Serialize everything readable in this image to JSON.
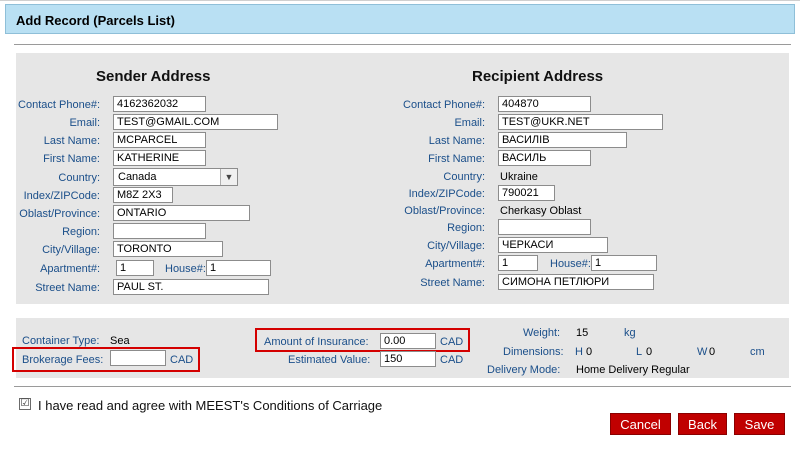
{
  "header": {
    "title": "Add Record (Parcels List)"
  },
  "sender": {
    "heading": "Sender Address",
    "contact_phone_label": "Contact Phone#:",
    "contact_phone": "4162362032",
    "email_label": "Email:",
    "email": "TEST@GMAIL.COM",
    "last_name_label": "Last Name:",
    "last_name": "MCPARCEL",
    "first_name_label": "First Name:",
    "first_name": "KATHERINE",
    "country_label": "Country:",
    "country": "Canada",
    "zip_label": "Index/ZIPCode:",
    "zip": "M8Z 2X3",
    "oblast_label": "Oblast/Province:",
    "oblast": "ONTARIO",
    "region_label": "Region:",
    "region": "",
    "city_label": "City/Village:",
    "city": "TORONTO",
    "apartment_label": "Apartment#:",
    "apartment": "1",
    "house_label": "House#:",
    "house": "1",
    "street_label": "Street Name:",
    "street": "PAUL ST."
  },
  "recipient": {
    "heading": "Recipient Address",
    "contact_phone_label": "Contact Phone#:",
    "contact_phone": "404870",
    "email_label": "Email:",
    "email": "TEST@UKR.NET",
    "last_name_label": "Last Name:",
    "last_name": "ВАСИЛІВ",
    "first_name_label": "First Name:",
    "first_name": "ВАСИЛЬ",
    "country_label": "Country:",
    "country": "Ukraine",
    "zip_label": "Index/ZIPCode:",
    "zip": "790021",
    "oblast_label": "Oblast/Province:",
    "oblast": "Cherkasy Oblast",
    "region_label": "Region:",
    "region": "",
    "city_label": "City/Village:",
    "city": "ЧЕРКАСИ",
    "apartment_label": "Apartment#:",
    "apartment": "1",
    "house_label": "House#:",
    "house": "1",
    "street_label": "Street Name:",
    "street": "СИМОНА ПЕТЛЮРИ"
  },
  "details": {
    "container_type_label": "Container Type:",
    "container_type": "Sea",
    "brokerage_label": "Brokerage Fees:",
    "brokerage": "",
    "brokerage_unit": "CAD",
    "insurance_label": "Amount of Insurance:",
    "insurance": "0.00",
    "insurance_unit": "CAD",
    "estimated_label": "Estimated Value:",
    "estimated": "150",
    "estimated_unit": "CAD",
    "weight_label": "Weight:",
    "weight": "15",
    "weight_unit": "kg",
    "dimensions_label": "Dimensions:",
    "h_label": "H",
    "h": "0",
    "l_label": "L",
    "l": "0",
    "w_label": "W",
    "w": "0",
    "dim_unit": "cm",
    "delivery_label": "Delivery Mode:",
    "delivery": "Home Delivery Regular"
  },
  "agreement": {
    "checked_mark": "☑",
    "text": "I have read and agree with MEEST's Conditions of Carriage"
  },
  "buttons": {
    "cancel": "Cancel",
    "back": "Back",
    "save": "Save"
  },
  "colors": {
    "accent": "#c00000",
    "label_blue": "#1b4f8a",
    "title_bg": "#b9e0f3",
    "highlight": "#d40000"
  }
}
